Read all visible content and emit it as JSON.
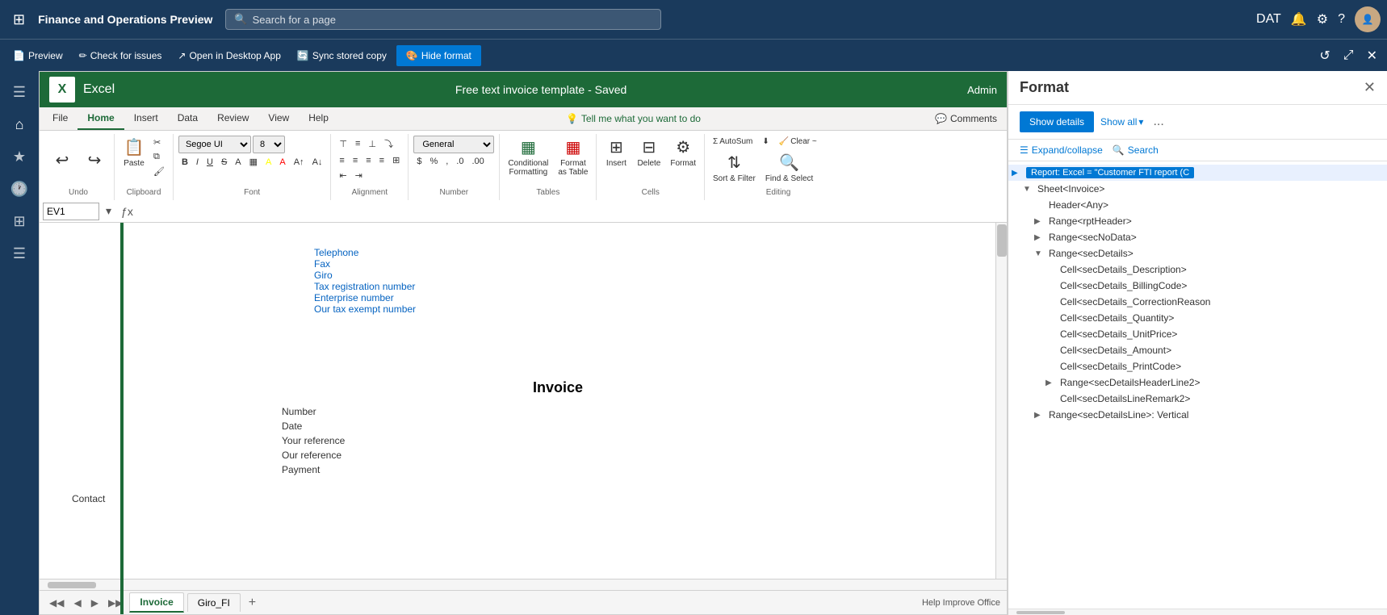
{
  "topNav": {
    "appTitle": "Finance and Operations Preview",
    "searchPlaceholder": "Search for a page",
    "envLabel": "DAT"
  },
  "toolbarStrip": {
    "previewLabel": "Preview",
    "checkIssuesLabel": "Check for issues",
    "openDesktopLabel": "Open in Desktop App",
    "syncLabel": "Sync stored copy",
    "hideFormatLabel": "Hide format"
  },
  "excelHeader": {
    "logoText": "X",
    "appName": "Excel",
    "docTitle": "Free text invoice template  -  Saved",
    "userName": "Admin"
  },
  "ribbonTabs": {
    "tabs": [
      "File",
      "Home",
      "Insert",
      "Data",
      "Review",
      "View",
      "Help"
    ],
    "activeTab": "Home",
    "tellMeLabel": "Tell me what you want to do",
    "commentsLabel": "Comments"
  },
  "ribbonGroups": {
    "clipboard": {
      "label": "Clipboard",
      "pasteLabel": "Paste",
      "cutLabel": "Cut",
      "copyLabel": "Copy",
      "formatPainterLabel": "Format Painter"
    },
    "font": {
      "label": "Font",
      "fontName": "Segoe UI",
      "fontSize": "8"
    },
    "alignment": {
      "label": "Alignment"
    },
    "number": {
      "label": "Number",
      "format": "General"
    },
    "tables": {
      "label": "Tables",
      "conditionalFormattingLabel": "Conditional Formatting",
      "formatAsTableLabel": "Format as Table"
    },
    "cells": {
      "label": "Cells",
      "insertLabel": "Insert",
      "deleteLabel": "Delete",
      "formatLabel": "Format"
    },
    "editing": {
      "label": "Editing",
      "autoSumLabel": "AutoSum",
      "fillLabel": "Fill",
      "clearLabel": "Clear ~",
      "sortFilterLabel": "Sort & Filter",
      "findSelectLabel": "Find & Select"
    }
  },
  "formulaBar": {
    "cellRef": "EV1",
    "formula": ""
  },
  "spreadsheet": {
    "links": [
      "Telephone",
      "Fax",
      "Giro",
      "Tax registration number",
      "Enterprise number",
      "Our tax exempt number"
    ],
    "invoiceTitle": "Invoice",
    "fields": [
      "Number",
      "Date",
      "Your reference",
      "Our reference",
      "Payment"
    ],
    "contactLabel": "Contact"
  },
  "sheetTabs": {
    "tabs": [
      "Invoice",
      "Giro_FI"
    ],
    "activeTab": "Invoice"
  },
  "statusBar": {
    "helpText": "Help Improve Office"
  },
  "rightPanel": {
    "title": "Format",
    "showDetailsLabel": "Show details",
    "showAllLabel": "Show all",
    "moreLabel": "...",
    "expandCollapseLabel": "Expand/collapse",
    "searchLabel": "Search",
    "closeLabel": "✕",
    "treeItems": [
      {
        "id": "report",
        "label": "Report: Excel = \"Customer FTI report (C",
        "indent": 0,
        "arrow": "▶",
        "isOpen": true,
        "highlight": true
      },
      {
        "id": "sheet-invoice",
        "label": "Sheet<Invoice>",
        "indent": 1,
        "arrow": "▼",
        "isOpen": true
      },
      {
        "id": "header-any",
        "label": "Header<Any>",
        "indent": 2,
        "arrow": "",
        "isOpen": false
      },
      {
        "id": "range-rptheader",
        "label": "Range<rptHeader>",
        "indent": 3,
        "arrow": "▶",
        "isOpen": false
      },
      {
        "id": "range-secnodata",
        "label": "Range<secNoData>",
        "indent": 3,
        "arrow": "▶",
        "isOpen": false
      },
      {
        "id": "range-secdetails",
        "label": "Range<secDetails>",
        "indent": 3,
        "arrow": "▼",
        "isOpen": true
      },
      {
        "id": "cell-secdesc",
        "label": "Cell<secDetails_Description>",
        "indent": 4,
        "arrow": "",
        "isOpen": false
      },
      {
        "id": "cell-secbill",
        "label": "Cell<secDetails_BillingCode>",
        "indent": 4,
        "arrow": "",
        "isOpen": false
      },
      {
        "id": "cell-seccorrect",
        "label": "Cell<secDetails_CorrectionReason",
        "indent": 4,
        "arrow": "",
        "isOpen": false
      },
      {
        "id": "cell-secqty",
        "label": "Cell<secDetails_Quantity>",
        "indent": 4,
        "arrow": "",
        "isOpen": false
      },
      {
        "id": "cell-secunit",
        "label": "Cell<secDetails_UnitPrice>",
        "indent": 4,
        "arrow": "",
        "isOpen": false
      },
      {
        "id": "cell-secamt",
        "label": "Cell<secDetails_Amount>",
        "indent": 4,
        "arrow": "",
        "isOpen": false
      },
      {
        "id": "cell-secprint",
        "label": "Cell<secDetails_PrintCode>",
        "indent": 4,
        "arrow": "",
        "isOpen": false
      },
      {
        "id": "range-secdetailsheader",
        "label": "Range<secDetailsHeaderLine2>",
        "indent": 4,
        "arrow": "▶",
        "isOpen": false
      },
      {
        "id": "cell-secdetailsremark",
        "label": "Cell<secDetailsLineRemark2>",
        "indent": 4,
        "arrow": "",
        "isOpen": false
      },
      {
        "id": "range-secdetailsline",
        "label": "Range<secDetailsLine>: Vertical",
        "indent": 3,
        "arrow": "▶",
        "isOpen": false
      }
    ]
  }
}
